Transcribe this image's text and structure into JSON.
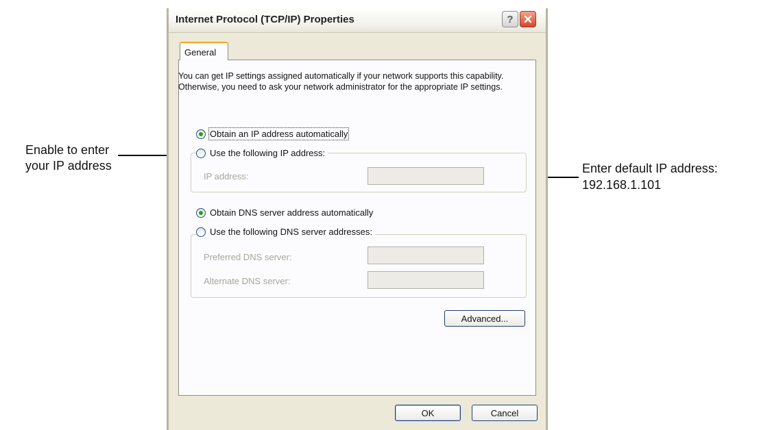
{
  "annotations": {
    "left_line1": "Enable to enter",
    "left_line2": "your IP address",
    "right_line1": "Enter default IP address:",
    "right_line2": "192.168.1.101"
  },
  "dialog": {
    "title": "Internet Protocol (TCP/IP) Properties",
    "help_label": "?",
    "tab_label": "General",
    "description": "You can get IP settings assigned automatically if your network supports this capability. Otherwise, you need to ask your network administrator for the appropriate IP settings.",
    "ip": {
      "auto_label": "Obtain an IP address automatically",
      "manual_label": "Use the following IP address:",
      "auto_selected": true,
      "ip_address_label": "IP address:",
      "ip_address_value": ""
    },
    "dns": {
      "auto_label": "Obtain DNS server address automatically",
      "manual_label": "Use the following DNS server addresses:",
      "auto_selected": true,
      "preferred_label": "Preferred DNS server:",
      "preferred_value": "",
      "alternate_label": "Alternate DNS server:",
      "alternate_value": ""
    },
    "advanced_label": "Advanced...",
    "ok_label": "OK",
    "cancel_label": "Cancel"
  },
  "colors": {
    "window_bg": "#ece9d8",
    "panel_bg": "#fcfcfe",
    "tab_accent": "#f5a623",
    "close_button": "#d8442a",
    "radio_selected": "#21a121"
  },
  "icons": [
    "help-icon",
    "close-icon"
  ]
}
